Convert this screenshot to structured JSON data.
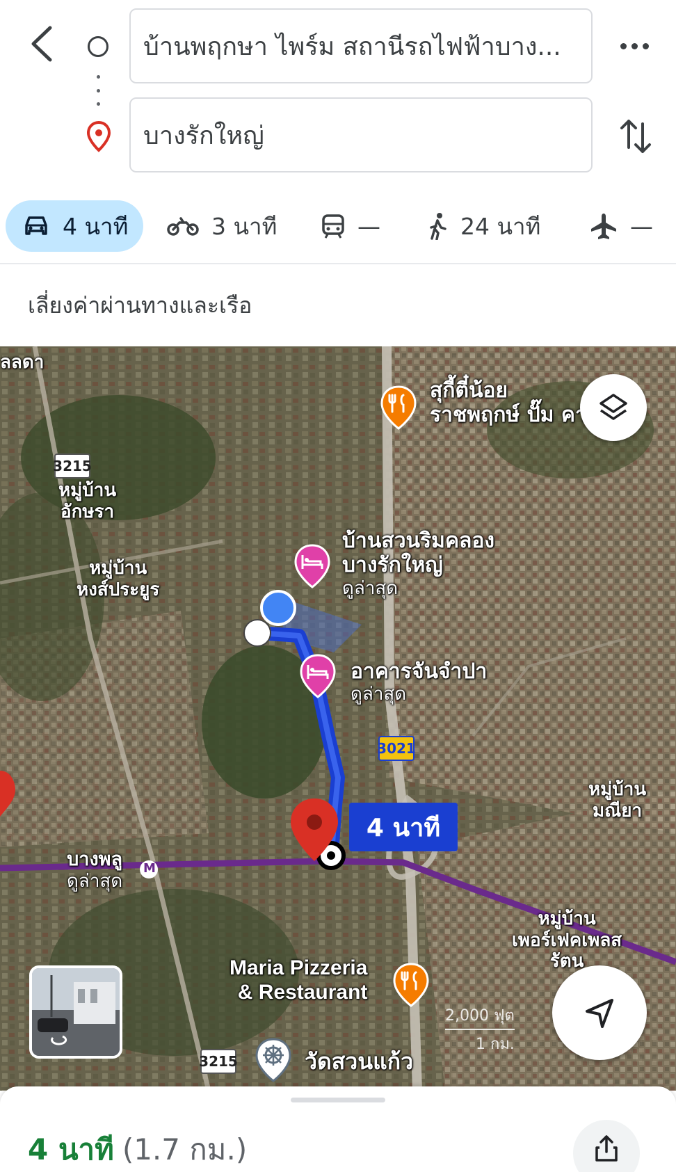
{
  "header": {
    "origin_value": "บ้านพฤกษา ไพร์ม สถานีรถไฟฟ้าบาง...",
    "destination_value": "บางรักใหญ่",
    "icons": {
      "back": "arrow-back-icon",
      "origin": "circle-origin-icon",
      "destination": "red-pin-icon",
      "more": "more-horizontal-icon",
      "swap": "swap-vertical-icon"
    }
  },
  "modes": [
    {
      "id": "car",
      "icon": "car-icon",
      "label": "4 นาที",
      "selected": true
    },
    {
      "id": "motorcycle",
      "icon": "motorcycle-icon",
      "label": "3 นาที",
      "selected": false
    },
    {
      "id": "transit",
      "icon": "train-icon",
      "label": "—",
      "selected": false
    },
    {
      "id": "walk",
      "icon": "walking-icon",
      "label": "24 นาที",
      "selected": false
    },
    {
      "id": "flight",
      "icon": "airplane-icon",
      "label": "—",
      "selected": false
    }
  ],
  "options": {
    "avoid_text": "เลี่ยงค่าผ่านทางและเรือ"
  },
  "map": {
    "labels": {
      "top_left": "ลลดา",
      "village_aksara": "หมู่บ้าน\nอักษรา",
      "village_hongsaprayoon": "หมู่บ้าน\nหงส์ประยูร",
      "bangphlu": "บางพลู",
      "bangphlu_sub": "ดูล่าสุด",
      "village_maneeya": "หมู่บ้าน\nมณียา",
      "village_perfect": "หมู่บ้าน\nเพอร์เฟคเพลส\nรัตน",
      "suki_title": "สุกี้ตี๋น้อย",
      "suki_sub": "ราชพฤกษ์ ปั๊ม คาล...",
      "bansuan_title": "บ้านสวนริมคลอง\nบางรักใหญ่",
      "bansuan_sub": "ดูล่าสุด",
      "akarn_title": "อาคารจันจำปา",
      "akarn_sub": "ดูล่าสุด",
      "maria": "Maria Pizzeria\n& Restaurant",
      "wat": "วัดสวนแก้ว",
      "metro_marker": "M"
    },
    "road_shields": {
      "r3215_top": "3215",
      "r3215_bottom": "3215",
      "r3021": "3021"
    },
    "route_time": "4 นาที",
    "scale_ft": "2,000 ฟุต",
    "scale_km": "1 กม.",
    "colors": {
      "route": "#1a3fd1",
      "purple_line": "#6a2a8c",
      "poi_food": "#f57c00",
      "poi_hotel": "#e040a8",
      "pin": "#d93025"
    }
  },
  "bottom_sheet": {
    "duration": "4 นาที",
    "distance": "(1.7 กม.)",
    "duration_color": "#188038"
  }
}
